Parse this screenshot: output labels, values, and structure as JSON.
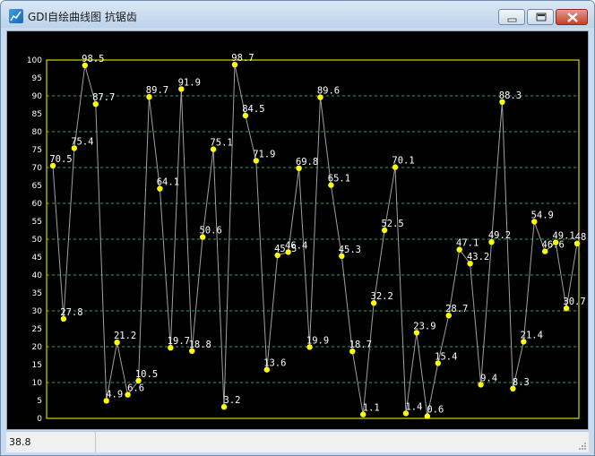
{
  "window": {
    "title": "GDI自绘曲线图 抗锯齿",
    "icon": "app-chart-icon",
    "controls": {
      "minimize_icon": "minimize-icon",
      "maximize_icon": "maximize-icon",
      "close_icon": "close-icon"
    }
  },
  "statusbar": {
    "value_text": "38.8"
  },
  "colors": {
    "background": "#000000",
    "frame": "#ffff00",
    "grid": "#3aa05a",
    "line": "#a0a0a0",
    "point": "#ffff00",
    "label": "#ffffff",
    "tick": "#ffffff"
  },
  "chart_data": {
    "type": "line",
    "ylim": [
      0,
      100
    ],
    "yticks": [
      0,
      5,
      10,
      15,
      20,
      25,
      30,
      35,
      40,
      45,
      50,
      55,
      60,
      65,
      70,
      75,
      80,
      85,
      90,
      95,
      100
    ],
    "grid": "horizontal dashed every 10",
    "values": [
      70.5,
      27.8,
      75.4,
      98.5,
      87.7,
      4.9,
      21.2,
      6.6,
      10.5,
      89.7,
      64.1,
      19.7,
      91.9,
      18.8,
      50.6,
      75.1,
      3.2,
      98.7,
      84.5,
      71.9,
      13.6,
      45.5,
      46.4,
      69.8,
      19.9,
      89.6,
      65.1,
      45.3,
      18.7,
      1.1,
      32.2,
      52.5,
      70.1,
      1.4,
      23.9,
      0.6,
      15.4,
      28.7,
      47.1,
      43.2,
      9.4,
      49.2,
      88.3,
      8.3,
      21.4,
      54.9,
      46.6,
      49.1,
      30.7,
      48.8
    ],
    "labels": [
      "70.5",
      "27.8",
      "75.4",
      "98.5",
      "87.7",
      "4.9",
      "21.2",
      "6.6",
      "10.5",
      "89.7",
      "64.1",
      "19.7",
      "91.9",
      "18.8",
      "50.6",
      "75.1",
      "3.2",
      "98.7",
      "84.5",
      "71.9",
      "13.6",
      "45.5",
      "46.4",
      "69.8",
      "19.9",
      "89.6",
      "65.1",
      "45.3",
      "18.7",
      "1.1",
      "32.2",
      "52.5",
      "70.1",
      "1.4",
      "23.9",
      "0.6",
      "15.4",
      "28.7",
      "47.1",
      "43.2",
      "9.4",
      "49.2",
      "88.3",
      "8.3",
      "21.4",
      "54.9",
      "46.6",
      "49.1",
      "30.7",
      "48"
    ]
  }
}
